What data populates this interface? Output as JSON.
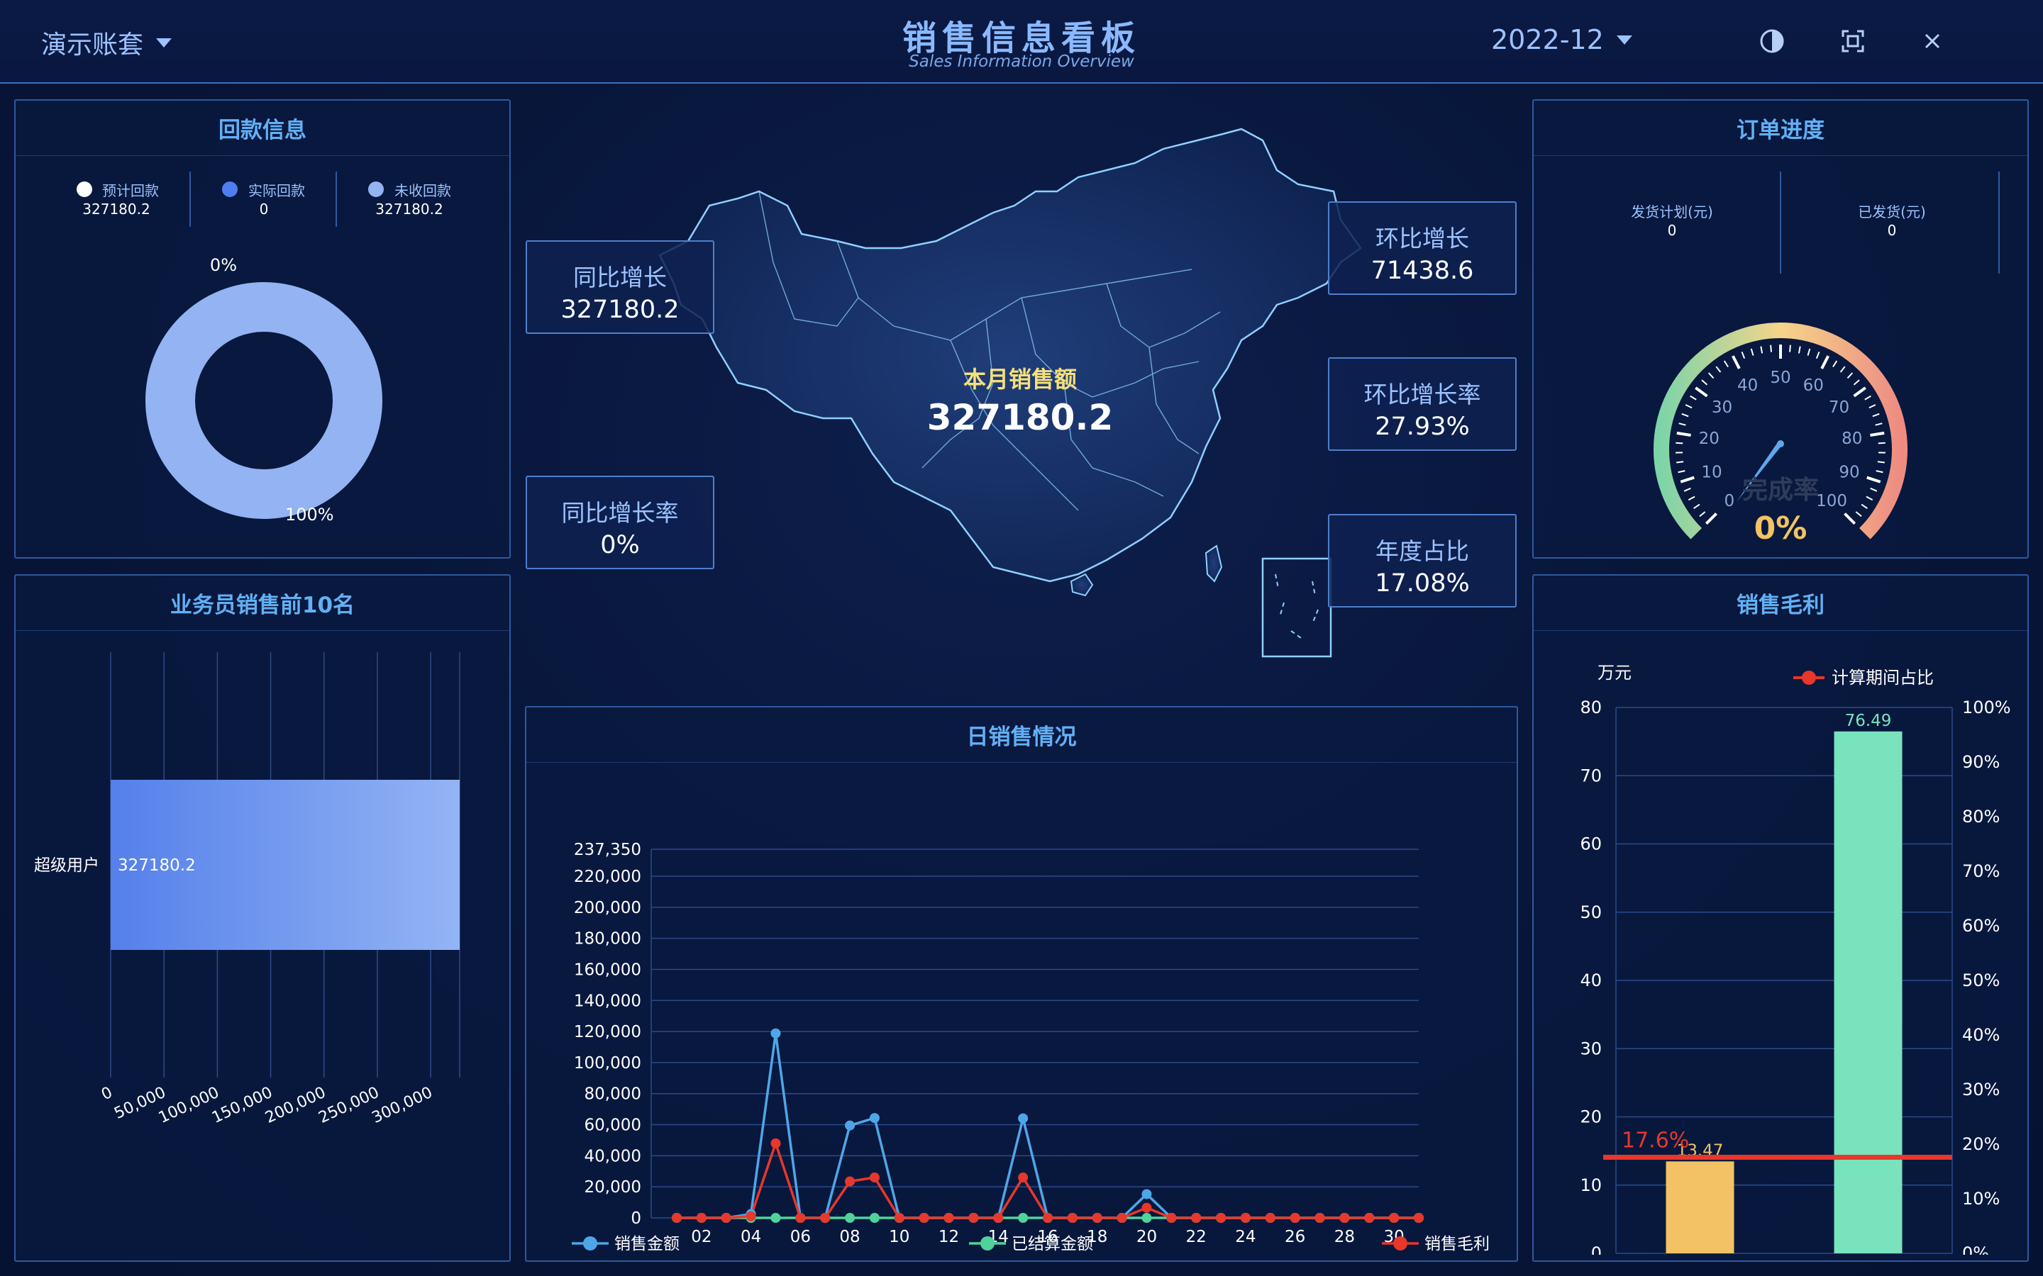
{
  "header": {
    "account_label": "演示账套",
    "title": "销售信息看板",
    "subtitle": "Sales Information Overview",
    "period": "2022-12"
  },
  "icons": {
    "theme": "contrast-icon",
    "fullscreen": "fullscreen-icon",
    "close": "close-icon"
  },
  "payment": {
    "title": "回款信息",
    "legend": [
      {
        "label": "预计回款",
        "value": "327180.2",
        "color": "#ffffff"
      },
      {
        "label": "实际回款",
        "value": "0",
        "color": "#4e7ef0"
      },
      {
        "label": "未收回款",
        "value": "327180.2",
        "color": "#94b3f2"
      }
    ],
    "donut_label_top": "0%",
    "donut_label_bottom": "100%"
  },
  "salesmen": {
    "title": "业务员销售前10名"
  },
  "map": {
    "headline": "本月销售额",
    "value": "327180.2"
  },
  "stats": {
    "yoy_growth": {
      "label": "同比增长",
      "value": "327180.2"
    },
    "yoy_rate": {
      "label": "同比增长率",
      "value": "0%"
    },
    "mom_growth": {
      "label": "环比增长",
      "value": "71438.6"
    },
    "mom_rate": {
      "label": "环比增长率",
      "value": "27.93%"
    },
    "year_share": {
      "label": "年度占比",
      "value": "17.08%"
    }
  },
  "orders": {
    "title": "订单进度",
    "plan_label": "发货计划(元)",
    "plan_value": "0",
    "shipped_label": "已发货(元)",
    "shipped_value": "0",
    "gauge_caption": "完成率",
    "gauge_value": "0%"
  },
  "daily": {
    "title": "日销售情况"
  },
  "profit": {
    "title": "销售毛利",
    "unit": "万元"
  },
  "colors": {
    "accent": "#62b0f5",
    "sales": "#4ea6e8",
    "settled": "#4fd39a",
    "profit": "#e8372b",
    "bar_month": "#f2c264",
    "bar_year": "#79e3bd"
  },
  "chart_data": [
    {
      "type": "pie",
      "title": "",
      "labels": [
        "实际回款",
        "未收回款"
      ],
      "values": [
        0,
        327180.2
      ],
      "annotations": [
        "0%",
        "100%"
      ]
    },
    {
      "type": "bar",
      "orientation": "horizontal",
      "title": "",
      "categories": [
        "超级用户"
      ],
      "values": [
        327180.2
      ],
      "data_labels": [
        "327180.2"
      ],
      "xlim": [
        0,
        327180.2
      ],
      "x_ticks": [
        "0",
        "50,000",
        "100,000",
        "150,000",
        "200,000",
        "250,000",
        "300,000"
      ],
      "grid": true
    },
    {
      "type": "line",
      "title": "",
      "x": [
        1,
        2,
        3,
        4,
        5,
        6,
        7,
        8,
        9,
        10,
        11,
        12,
        13,
        14,
        15,
        16,
        17,
        18,
        19,
        20,
        21,
        22,
        23,
        24,
        25,
        26,
        27,
        28,
        29,
        30,
        31
      ],
      "x_ticks": [
        "02",
        "04",
        "06",
        "08",
        "10",
        "12",
        "14",
        "16",
        "18",
        "20",
        "22",
        "24",
        "26",
        "28",
        "30"
      ],
      "y_ticks": [
        "0",
        "20,000",
        "40,000",
        "60,000",
        "80,000",
        "100,000",
        "120,000",
        "140,000",
        "160,000",
        "180,000",
        "200,000",
        "220,000",
        "237,350"
      ],
      "ylim": [
        0,
        237350
      ],
      "legend_position": "bottom",
      "series": [
        {
          "name": "销售金额",
          "values": [
            0,
            0,
            0,
            2500,
            118800,
            0,
            0,
            59500,
            64300,
            0,
            0,
            0,
            0,
            0,
            64100,
            0,
            0,
            0,
            0,
            15300,
            0,
            0,
            0,
            0,
            0,
            0,
            0,
            0,
            0,
            0,
            0
          ]
        },
        {
          "name": "已结算金额",
          "values": [
            0,
            0,
            0,
            0,
            0,
            0,
            0,
            0,
            0,
            0,
            0,
            0,
            0,
            0,
            0,
            0,
            0,
            0,
            0,
            0,
            0,
            0,
            0,
            0,
            0,
            0,
            0,
            0,
            0,
            0,
            0
          ]
        },
        {
          "name": "销售毛利",
          "values": [
            0,
            0,
            0,
            1000,
            48000,
            0,
            0,
            23500,
            26000,
            0,
            0,
            0,
            0,
            0,
            26000,
            0,
            0,
            0,
            0,
            6500,
            0,
            0,
            0,
            0,
            0,
            0,
            0,
            0,
            0,
            0,
            0
          ]
        }
      ]
    },
    {
      "type": "bar",
      "title": "",
      "categories": [
        "本月毛利",
        "本年毛利"
      ],
      "values": [
        13.47,
        76.49
      ],
      "data_labels": [
        "13.47",
        "76.49"
      ],
      "ylabel": "万元",
      "ylim": [
        0,
        80
      ],
      "y_ticks": [
        "0",
        "10",
        "20",
        "30",
        "40",
        "50",
        "60",
        "70",
        "80"
      ],
      "y2_ticks": [
        "0%",
        "10%",
        "20%",
        "30%",
        "40%",
        "50%",
        "60%",
        "70%",
        "80%",
        "90%",
        "100%"
      ],
      "y2lim": [
        0,
        100
      ],
      "line_series": {
        "name": "计算期间占比",
        "value": 17.6,
        "label": "17.6%"
      },
      "legend_position": "top-right"
    },
    {
      "type": "gauge",
      "title": "",
      "value": 0,
      "min": 0,
      "max": 100,
      "ticks": [
        "0",
        "10",
        "20",
        "30",
        "40",
        "50",
        "60",
        "70",
        "80",
        "90",
        "100"
      ],
      "caption": "完成率",
      "value_label": "0%"
    }
  ]
}
